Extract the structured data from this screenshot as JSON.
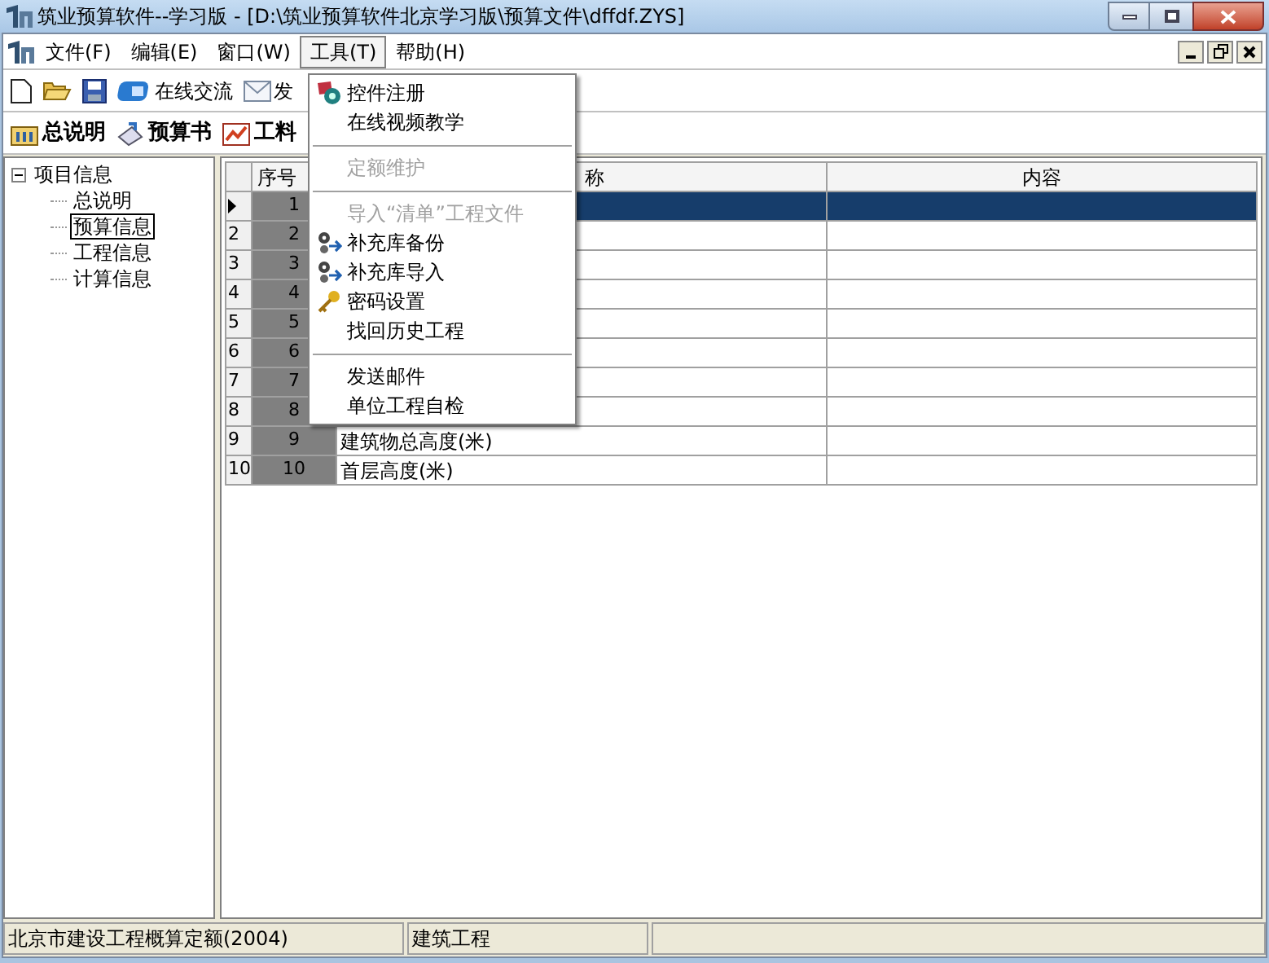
{
  "window": {
    "title": "筑业预算软件--学习版 - [D:\\筑业预算软件北京学习版\\预算文件\\dffdf.ZYS]"
  },
  "menu_bar": [
    {
      "label": "文件(F)",
      "selected": false
    },
    {
      "label": "编辑(E)",
      "selected": false
    },
    {
      "label": "窗口(W)",
      "selected": false
    },
    {
      "label": "工具(T)",
      "selected": true
    },
    {
      "label": "帮助(H)",
      "selected": false
    }
  ],
  "toolbar": {
    "buttons": [
      {
        "kind": "new"
      },
      {
        "kind": "open"
      },
      {
        "kind": "save"
      },
      {
        "kind": "chat",
        "label": "在线交流"
      },
      {
        "kind": "mail",
        "label": "发"
      }
    ]
  },
  "view_tabs": [
    {
      "kind": "doc",
      "label": "总说明"
    },
    {
      "kind": "book",
      "label": "预算书"
    },
    {
      "kind": "chart",
      "label": "工料"
    }
  ],
  "tree": [
    {
      "label": "项目信息",
      "expanded": true,
      "selected": false,
      "children": [
        {
          "label": "总说明",
          "selected": false
        },
        {
          "label": "预算信息",
          "selected": true
        },
        {
          "label": "工程信息",
          "selected": false
        },
        {
          "label": "计算信息",
          "selected": false
        }
      ]
    }
  ],
  "table": {
    "columns": [
      "序号",
      "称",
      "内容"
    ],
    "rows": [
      {
        "selected": true,
        "seq": "1"
      },
      {
        "selected": false,
        "row_label": "2",
        "seq": "2"
      },
      {
        "selected": false,
        "row_label": "3",
        "seq": "3"
      },
      {
        "selected": false,
        "row_label": "4",
        "seq": "4"
      },
      {
        "selected": false,
        "row_label": "5",
        "seq": "5"
      },
      {
        "selected": false,
        "row_label": "6",
        "seq": "6"
      },
      {
        "selected": false,
        "row_label": "7",
        "seq": "7"
      },
      {
        "selected": false,
        "row_label": "8",
        "seq": "8"
      },
      {
        "selected": false,
        "row_label": "9",
        "seq": "9",
        "name": "建筑物总高度(米)"
      },
      {
        "selected": false,
        "row_label": "10",
        "seq": "10",
        "name": "首层高度(米)"
      }
    ]
  },
  "tools_menu": [
    {
      "kind": "register",
      "label": "控件注册",
      "disabled": false
    },
    {
      "kind": "item",
      "label": "在线视频教学",
      "disabled": false
    },
    {
      "kind": "separator"
    },
    {
      "kind": "item",
      "label": "定额维护",
      "disabled": true
    },
    {
      "kind": "separator"
    },
    {
      "kind": "item",
      "label": "导入“清单”工程文件",
      "disabled": true
    },
    {
      "kind": "backup",
      "label": "补充库备份",
      "disabled": false
    },
    {
      "kind": "backup",
      "label": "补充库导入",
      "disabled": false
    },
    {
      "kind": "key",
      "label": "密码设置",
      "disabled": false
    },
    {
      "kind": "item",
      "label": "找回历史工程",
      "disabled": false
    },
    {
      "kind": "separator"
    },
    {
      "kind": "item",
      "label": "发送邮件",
      "disabled": false
    },
    {
      "kind": "item",
      "label": "单位工程自检",
      "disabled": false
    }
  ],
  "status_bar": [
    "北京市建设工程概算定额(2004)",
    "建筑工程"
  ]
}
